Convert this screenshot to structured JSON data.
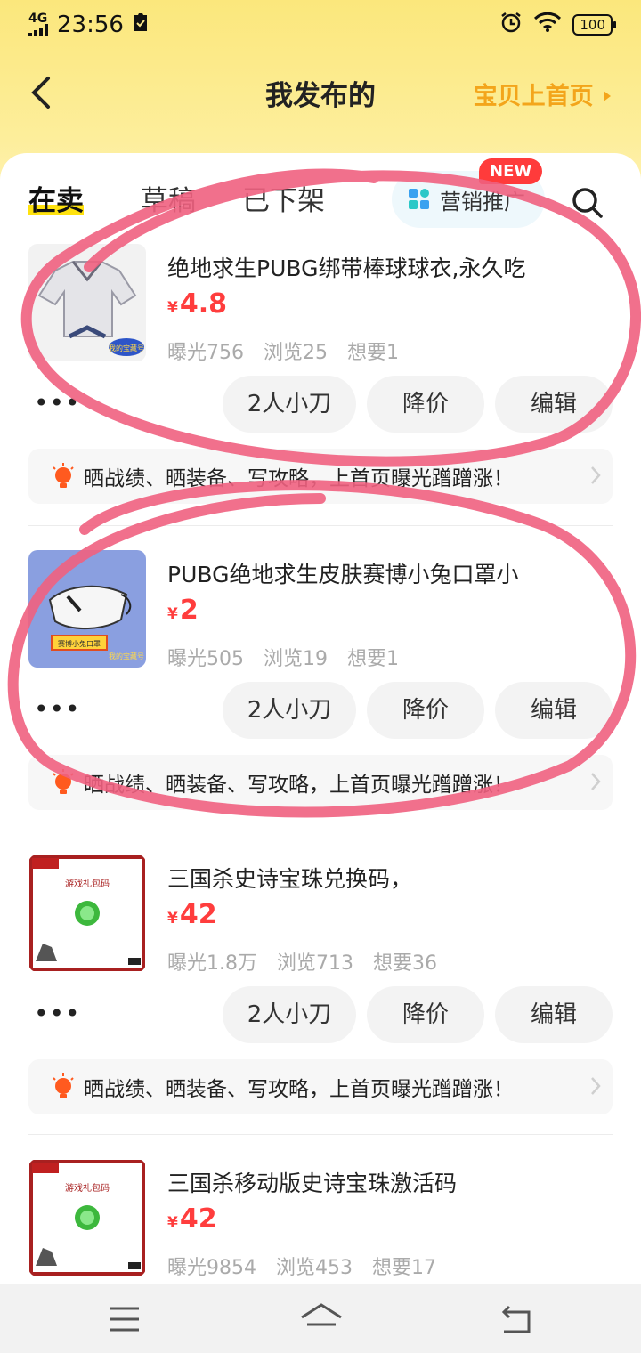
{
  "status_bar": {
    "network": "4G",
    "time": "23:56",
    "battery": "100"
  },
  "header": {
    "title": "我发布的",
    "promo_link": "宝贝上首页"
  },
  "tabs": [
    {
      "label": "在卖",
      "active": true
    },
    {
      "label": "草稿",
      "active": false
    },
    {
      "label": "已下架",
      "active": false
    }
  ],
  "marketing": {
    "label": "营销推广",
    "badge": "NEW"
  },
  "items": [
    {
      "title": "绝地求生PUBG绑带棒球球衣,永久吃",
      "currency": "¥",
      "price": "4.8",
      "exposure": "曝光756",
      "views": "浏览25",
      "wants": "想要1"
    },
    {
      "title": "PUBG绝地求生皮肤赛博小兔口罩小",
      "currency": "¥",
      "price": "2",
      "exposure": "曝光505",
      "views": "浏览19",
      "wants": "想要1"
    },
    {
      "title": "三国杀史诗宝珠兑换码，",
      "currency": "¥",
      "price": "42",
      "exposure": "曝光1.8万",
      "views": "浏览713",
      "wants": "想要36"
    },
    {
      "title": "三国杀移动版史诗宝珠激活码",
      "currency": "¥",
      "price": "42",
      "exposure": "曝光9854",
      "views": "浏览453",
      "wants": "想要17"
    }
  ],
  "actions": {
    "more": "•••",
    "bargain": "2人小刀",
    "reduce_price": "降价",
    "edit": "编辑"
  },
  "tip": "晒战绩、晒装备、写攻略，上首页曝光蹭蹭涨！",
  "thumb_text": {
    "item1_sticker": "我的宝藏号",
    "item2_caption": "赛博小兔口罩",
    "item2_sticker": "我的宝藏号",
    "gift_card": "游戏礼包码"
  },
  "colors": {
    "accent_yellow": "#ffe20e",
    "price_red": "#ff3d3d",
    "promo_orange": "#f3a51b",
    "annotation_stroke": "#f06080"
  }
}
